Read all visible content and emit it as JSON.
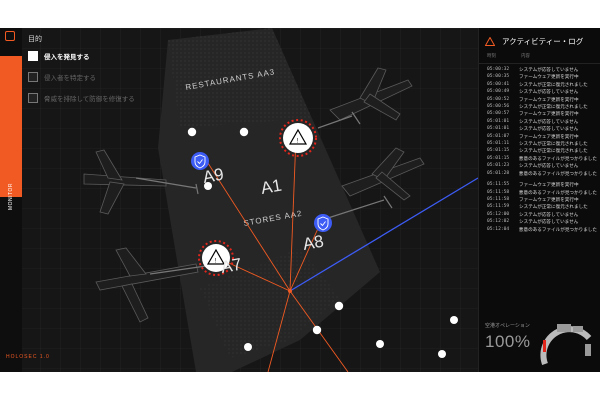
{
  "sidebar": {
    "tab_label": "MONITOR",
    "logo_icon": "shield-logo-icon",
    "bottom_text": "HOLOSEC 1.0"
  },
  "objectives": {
    "title": "目的",
    "items": [
      {
        "label": "侵入を発見する",
        "state": "active"
      },
      {
        "label": "侵入者を特定する",
        "state": "locked"
      },
      {
        "label": "脅威を排除して防御を修復する",
        "state": "locked"
      }
    ]
  },
  "map": {
    "zones": [
      "RESTAURANTS AA3",
      "STORES AA2"
    ],
    "gates": [
      {
        "label": "A1",
        "status": "alert"
      },
      {
        "label": "A9",
        "status": "secure"
      },
      {
        "label": "A8",
        "status": "secure"
      },
      {
        "label": "A7",
        "status": "alert"
      }
    ]
  },
  "activity_log": {
    "title": "アクティビティー・ログ",
    "col_time": "時刻",
    "col_content": "内容",
    "entries": [
      {
        "time": "05:00:32",
        "msg": "システムが応答していません"
      },
      {
        "time": "05:00:35",
        "msg": "ファームウェア更新を実行中"
      },
      {
        "time": "05:00:41",
        "msg": "システムが正常に復元されました"
      },
      {
        "time": "05:00:49",
        "msg": "システムが応答していません"
      },
      {
        "time": "05:00:52",
        "msg": "ファームウェア更新を実行中"
      },
      {
        "time": "05:00:56",
        "msg": "システムが正常に復元されました"
      },
      {
        "time": "05:00:57",
        "msg": "ファームウェア更新を実行中"
      },
      {
        "time": "05:01:01",
        "msg": "システムが応答していません"
      },
      {
        "time": "05:01:01",
        "msg": "システムが応答していません"
      },
      {
        "time": "05:01:07",
        "msg": "ファームウェア更新を実行中"
      },
      {
        "time": "05:01:11",
        "msg": "システムが正常に復元されました"
      },
      {
        "time": "05:01:15",
        "msg": "システムが正常に復元されました"
      },
      {
        "time": "05:01:15",
        "msg": "悪意のあるファイルが見つかりました"
      },
      {
        "time": "05:01:23",
        "msg": "システムが応答していません"
      },
      {
        "time": "05:01:28",
        "msg": "悪意のあるファイルが見つかりました"
      },
      {
        "time": "05:11:55",
        "msg": "ファームウェア更新を実行中"
      },
      {
        "time": "05:11:58",
        "msg": "悪意のあるファイルが見つかりました"
      },
      {
        "time": "05:11:58",
        "msg": "ファームウェア更新を実行中"
      },
      {
        "time": "05:11:59",
        "msg": "システムが正常に復元されました"
      },
      {
        "time": "05:12:00",
        "msg": "システムが応答していません"
      },
      {
        "time": "05:12:02",
        "msg": "システムが応答していません"
      },
      {
        "time": "05:12:04",
        "msg": "悪意のあるファイルが見つかりました"
      }
    ]
  },
  "operations": {
    "label": "空港オペレーション",
    "value": "100%",
    "level": 1.0
  },
  "colors": {
    "accent": "#f15a22",
    "secure": "#3d5cf5",
    "alert": "#e2261c",
    "background": "#141414"
  }
}
